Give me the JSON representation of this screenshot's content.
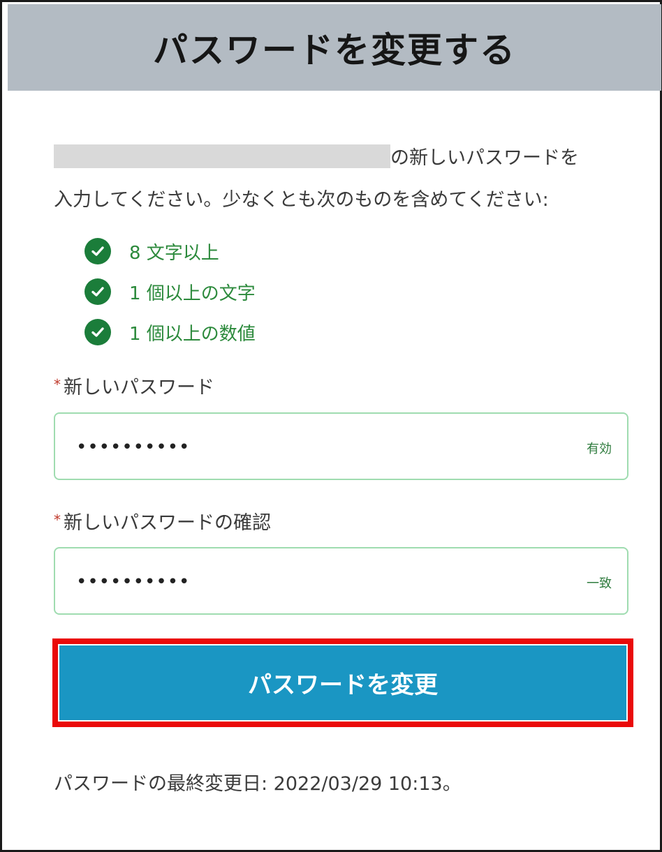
{
  "header": {
    "title": "パスワードを変更する"
  },
  "intro": {
    "line1_suffix": "の新しいパスワードを",
    "line2": "入力してください。少なくとも次のものを含めてください:"
  },
  "requirements": [
    {
      "text": "8 文字以上",
      "status_icon": "check-circle-icon"
    },
    {
      "text": "1 個以上の文字",
      "status_icon": "check-circle-icon"
    },
    {
      "text": "1 個以上の数値",
      "status_icon": "check-circle-icon"
    }
  ],
  "new_password": {
    "required_mark": "*",
    "label": "新しいパスワード",
    "value": "••••••••••",
    "status": "有効"
  },
  "confirm_password": {
    "required_mark": "*",
    "label": "新しいパスワードの確認",
    "value": "••••••••••",
    "status": "一致"
  },
  "submit": {
    "label": "パスワードを変更"
  },
  "footer": {
    "last_changed": "パスワードの最終変更日: 2022/03/29 10:13。"
  },
  "colors": {
    "header_bg": "#b3bbc3",
    "accent_button": "#1a96c3",
    "highlight_border": "#ea0a0a",
    "check_green": "#1b7d3a",
    "valid_text": "#2c8a3c",
    "field_border": "#9fdcb0"
  }
}
